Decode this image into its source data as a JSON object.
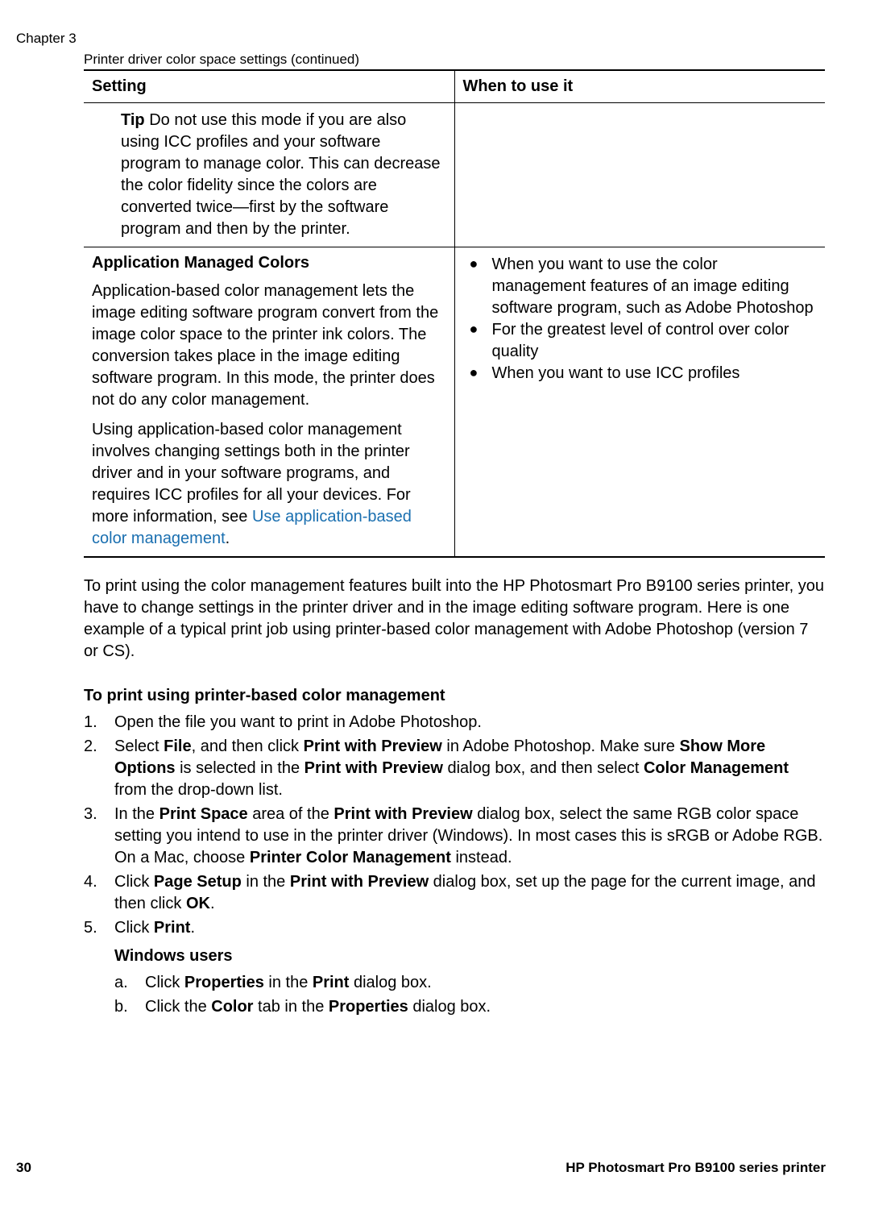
{
  "chapter": "Chapter 3",
  "tableCaption": "Printer driver color space settings (continued)",
  "headers": {
    "setting": "Setting",
    "when": "When to use it"
  },
  "row1": {
    "tipLabel": "Tip",
    "tipText": "Do not use this mode if you are also using ICC profiles and your software program to manage color. This can decrease the color fidelity since the colors are converted twice—first by the software program and then by the printer."
  },
  "row2": {
    "heading": "Application Managed Colors",
    "para1": "Application-based color management lets the image editing software program convert from the image color space to the printer ink colors. The conversion takes place in the image editing software program. In this mode, the printer does not do any color management.",
    "para2a": "Using application-based color management involves changing settings both in the printer driver and in your software programs, and requires ICC profiles for all your devices. For more information, see ",
    "para2link": "Use application-based color management",
    "para2b": ".",
    "bullets": {
      "b1": "When you want to use the color management features of an image editing software program, such as Adobe Photoshop",
      "b2": "For the greatest level of control over color quality",
      "b3": "When you want to use ICC profiles"
    }
  },
  "mainPara": "To print using the color management features built into the HP Photosmart Pro B9100 series printer, you have to change settings in the printer driver and in the image editing software program. Here is one example of a typical print job using printer-based color management with Adobe Photoshop (version 7 or CS).",
  "subheading": "To print using printer-based color management",
  "steps": {
    "s1": "Open the file you want to print in Adobe Photoshop.",
    "s2a": "Select ",
    "s2_file": "File",
    "s2b": ", and then click ",
    "s2_pwp": "Print with Preview",
    "s2c": " in Adobe Photoshop. Make sure ",
    "s2_smo": "Show More Options",
    "s2d": " is selected in the ",
    "s2_pwp2": "Print with Preview",
    "s2e": " dialog box, and then select ",
    "s2_cm": "Color Management",
    "s2f": " from the drop-down list.",
    "s3a": "In the ",
    "s3_ps": "Print Space",
    "s3b": " area of the ",
    "s3_pwp": "Print with Preview",
    "s3c": " dialog box, select the same RGB color space setting you intend to use in the printer driver (Windows). In most cases this is sRGB or Adobe RGB. On a Mac, choose ",
    "s3_pcm": "Printer Color Management",
    "s3d": " instead.",
    "s4a": "Click ",
    "s4_psu": "Page Setup",
    "s4b": " in the ",
    "s4_pwp": "Print with Preview",
    "s4c": " dialog box, set up the page for the current image, and then click ",
    "s4_ok": "OK",
    "s4d": ".",
    "s5a": "Click ",
    "s5_print": "Print",
    "s5b": "."
  },
  "winUsers": "Windows users",
  "winSteps": {
    "a1": "Click ",
    "a_prop": "Properties",
    "a2": " in the ",
    "a_print": "Print",
    "a3": " dialog box.",
    "b1": "Click the ",
    "b_color": "Color",
    "b2": " tab in the ",
    "b_prop": "Properties",
    "b3": " dialog box."
  },
  "footer": {
    "page": "30",
    "product": "HP Photosmart Pro B9100 series printer"
  }
}
